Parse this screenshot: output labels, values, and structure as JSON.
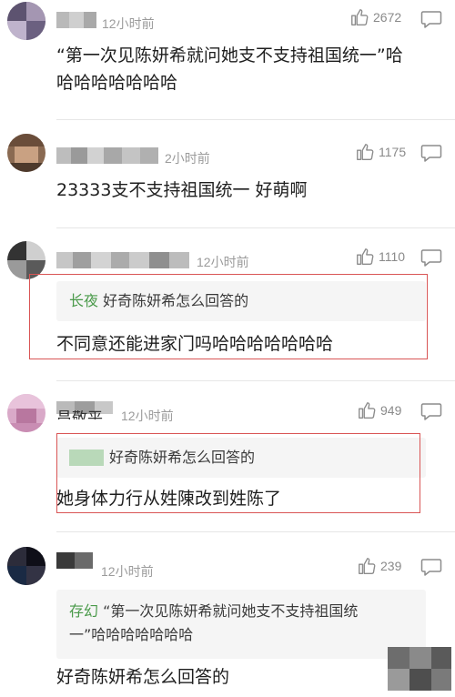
{
  "comments": [
    {
      "time": "12小时前",
      "likes": "2672",
      "text_line1": "“第一次见陈妍希就问她支不支持祖国统一”哈",
      "text_line2": "哈哈哈哈哈哈哈"
    },
    {
      "time": "2小时前",
      "likes": "1175",
      "text": "23333支不支持祖国统一 好萌啊"
    },
    {
      "time": "12小时前",
      "likes": "1110",
      "quote_name": "长夜",
      "quote_text": "好奇陈妍希怎么回答的",
      "text": "不同意还能进家门吗哈哈哈哈哈哈哈"
    },
    {
      "username_fragment": "昌敬平",
      "time": "12小时前",
      "likes": "949",
      "quote_text": "好奇陈妍希怎么回答的",
      "text": "她身体力行从姓陳改到姓陈了"
    },
    {
      "time": "12小时前",
      "likes": "239",
      "quote_name": "存幻",
      "quote_text_line1": "“第一次见陈妍希就问她支不支持祖国统",
      "quote_text_line2": "一”哈哈哈哈哈哈哈",
      "text": "好奇陈妍希怎么回答的"
    }
  ],
  "icons": {
    "like": "thumbs-up-icon",
    "reply": "comment-bubble-icon"
  },
  "colors": {
    "quote_name": "#4a9a4a",
    "highlight_box": "#d95555",
    "muted_text": "#9b9b9b"
  }
}
